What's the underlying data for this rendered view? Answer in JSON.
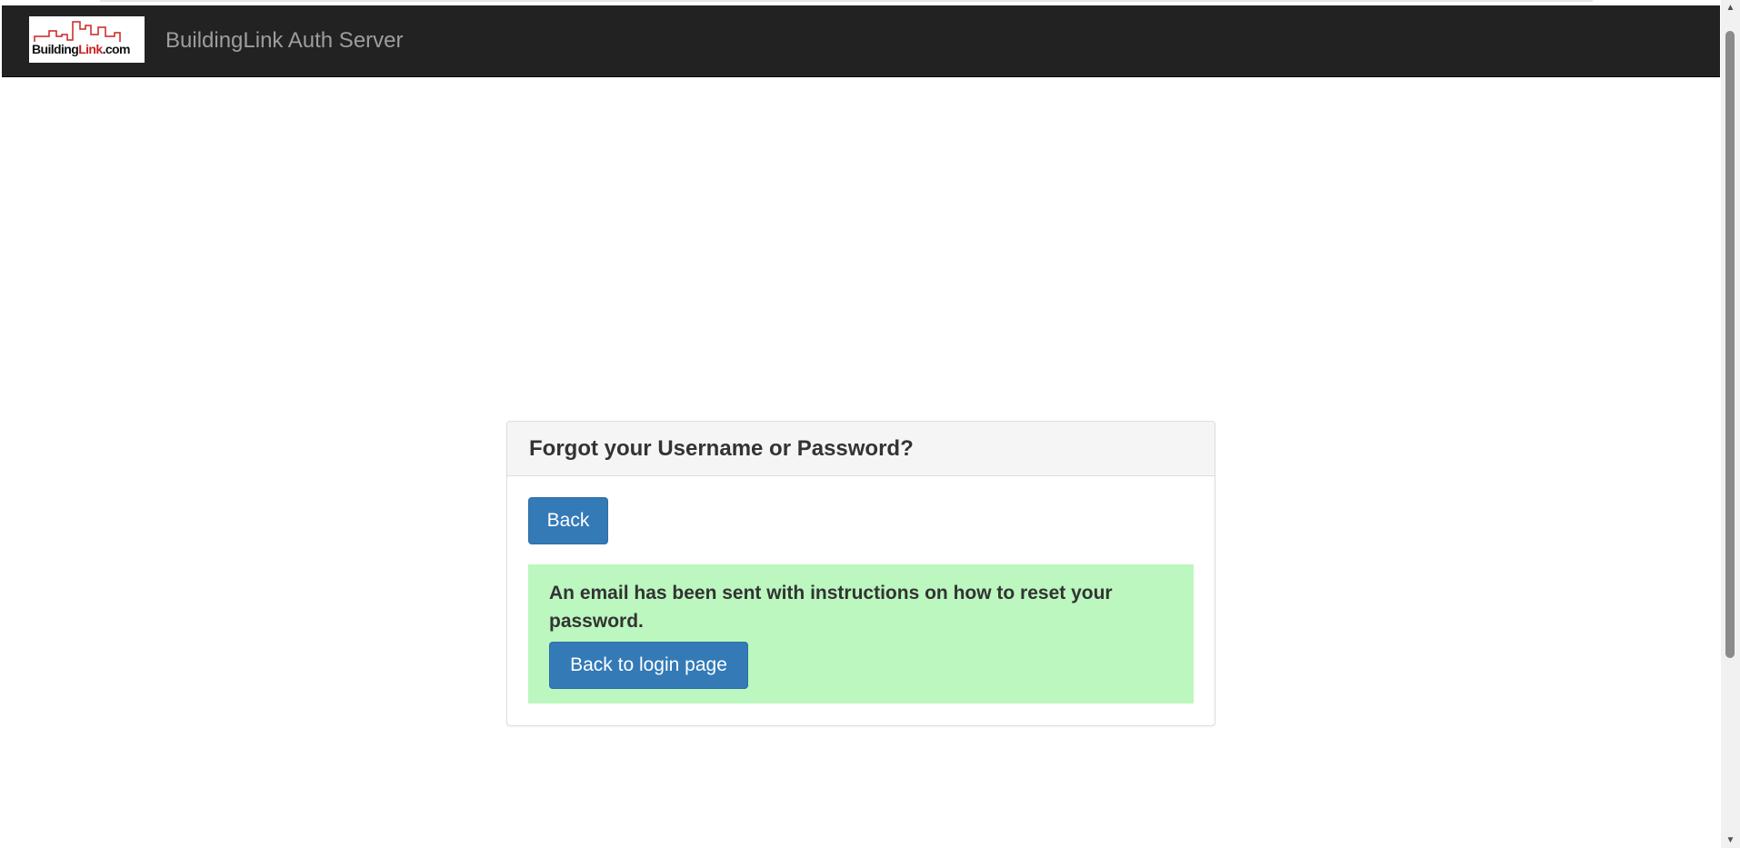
{
  "navbar": {
    "brand_title": "BuildingLink Auth Server",
    "logo": {
      "text_part1": "Building",
      "text_part2": "Link",
      "text_part3": ".com",
      "accent_color": "#cc2222"
    },
    "background_color": "#222222"
  },
  "panel": {
    "heading": "Forgot your Username or Password?",
    "back_button_label": "Back",
    "alert": {
      "message": "An email has been sent with instructions on how to reset your password.",
      "button_label": "Back to login page",
      "background_color": "#bbf7bf"
    },
    "button_color": "#337ab7"
  },
  "scrollbar": {
    "up_icon": "triangle-up-icon",
    "down_icon": "triangle-down-icon"
  }
}
